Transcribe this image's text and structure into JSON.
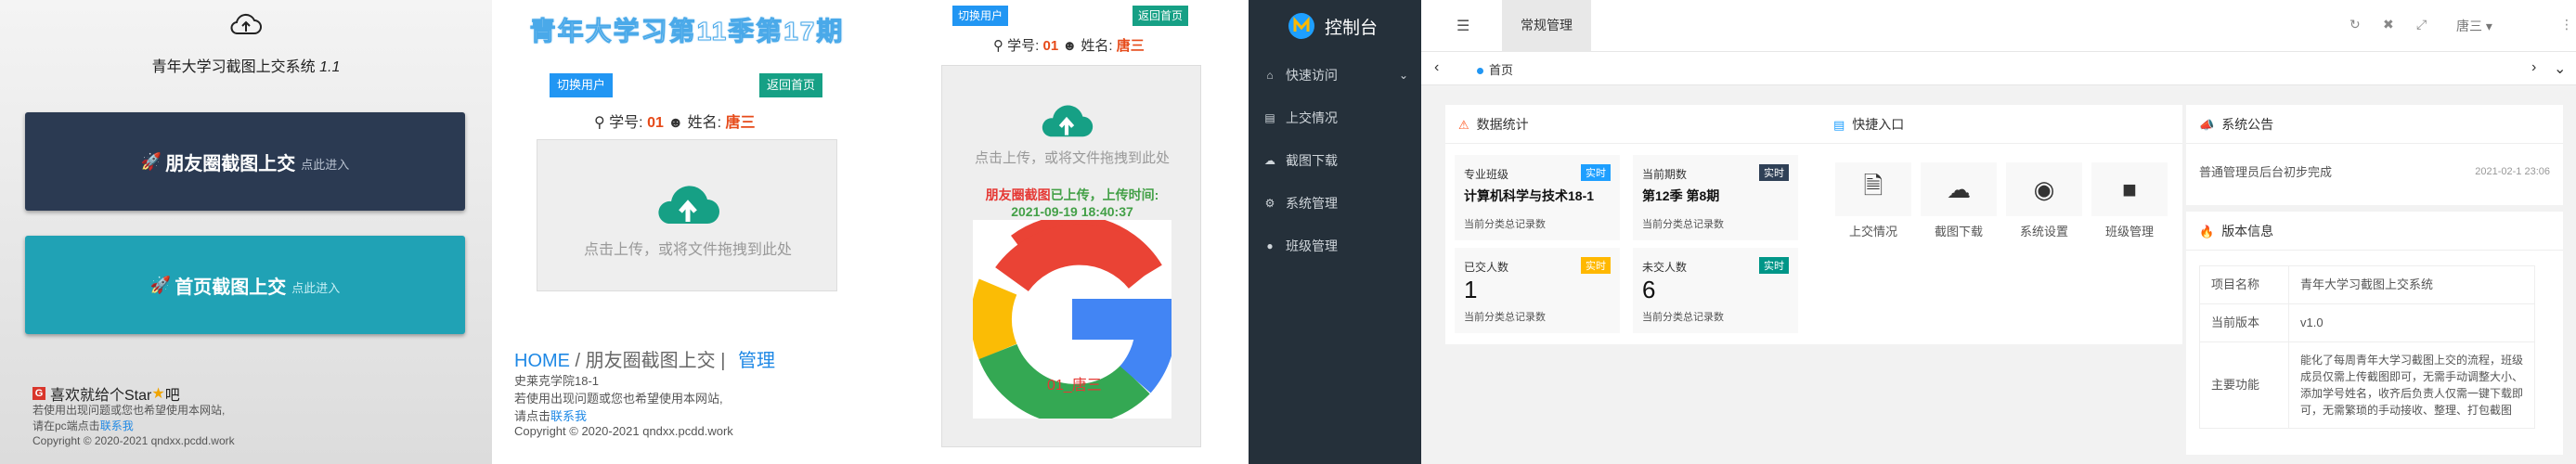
{
  "panel1": {
    "system_title": "青年大学习截图上交系统",
    "version": "1.1",
    "btn_friend": {
      "icon": "rocket-icon",
      "label": "朋友圈截图上交",
      "sub": "点此进入"
    },
    "btn_home": {
      "icon": "rocket-icon",
      "label": "首页截图上交",
      "sub": "点此进入"
    },
    "star_text": "喜欢就给个Star",
    "star_suffix": "吧",
    "footer_line1": "若使用出现问题或您也希望使用本网站,",
    "footer_line2_prefix": "请在pc端点击",
    "contact": "联系我",
    "copyright": "Copyright © 2020-2021 qndxx.pcdd.work"
  },
  "panel2": {
    "hero": "青年大学习第11季第17期",
    "switch_user": "切换用户",
    "back_home": "返回首页",
    "student_no_label": "学号:",
    "student_no": "01",
    "name_label": "姓名:",
    "name": "唐三",
    "upload_hint": "点击上传，或将文件拖拽到此处",
    "crumb_home": "HOME",
    "crumb_sep": " / ",
    "crumb_page": "朋友圈截图上交",
    "crumb_bar": " | ",
    "crumb_manage": "管理",
    "school": "史莱克学院18-1",
    "footer_line1": "若使用出现问题或您也希望使用本网站,",
    "footer_line2_prefix": "请点击",
    "contact": "联系我",
    "copyright": "Copyright © 2020-2021 qndxx.pcdd.work"
  },
  "panel3": {
    "switch_user": "切换用户",
    "back_home": "返回首页",
    "student_no_label": "学号:",
    "student_no": "01",
    "name_label": "姓名:",
    "name": "唐三",
    "upload_hint": "点击上传，或将文件拖拽到此处",
    "status_red": "朋友圈截图",
    "status_green": "已上传，上传时间:",
    "upload_time": "2021-09-19 18:40:37",
    "overlay": "01_唐三"
  },
  "admin": {
    "title": "控制台",
    "menu": [
      {
        "icon": "home-icon",
        "label": "快速访问"
      },
      {
        "icon": "file-icon",
        "label": "上交情况"
      },
      {
        "icon": "cloud-download-icon",
        "label": "截图下载"
      },
      {
        "icon": "gears-icon",
        "label": "系统管理"
      },
      {
        "icon": "user-icon",
        "label": "班级管理"
      }
    ],
    "top_tab": "常规管理",
    "user": "唐三",
    "page_tab": "首页",
    "stats_title": "数据统计",
    "stats": [
      {
        "title": "专业班级",
        "badge": "实时",
        "badge_color": "#1e9fff",
        "value": "计算机科学与技术18-1",
        "desc": "当前分类总记录数"
      },
      {
        "title": "当前期数",
        "badge": "实时",
        "badge_color": "#2f4056",
        "value": "第12季 第8期",
        "desc": "当前分类总记录数"
      },
      {
        "title": "已交人数",
        "badge": "实时",
        "badge_color": "#ffb800",
        "value": "1",
        "desc": "当前分类总记录数"
      },
      {
        "title": "未交人数",
        "badge": "实时",
        "badge_color": "#009688",
        "value": "6",
        "desc": "当前分类总记录数"
      }
    ],
    "quick_title": "快捷入口",
    "quick": [
      {
        "icon": "file-text-icon",
        "label": "上交情况"
      },
      {
        "icon": "cloud-download-icon",
        "label": "截图下载"
      },
      {
        "icon": "settings-icon",
        "label": "系统设置"
      },
      {
        "icon": "user-icon",
        "label": "班级管理"
      }
    ],
    "notice_title": "系统公告",
    "notice_text": "普通管理员后台初步完成",
    "notice_date": "2021-02-1 23:06",
    "version_title": "版本信息",
    "version_rows": [
      {
        "k": "项目名称",
        "v": "青年大学习截图上交系统"
      },
      {
        "k": "当前版本",
        "v": "v1.0"
      },
      {
        "k": "主要功能",
        "v": "能化了每周青年大学习截图上交的流程，班级成员仅需上传截图即可，无需手动调整大小、添加学号姓名，收齐后负责人仅需一键下载即可，无需繁琐的手动接收、整理、打包截图"
      }
    ]
  }
}
